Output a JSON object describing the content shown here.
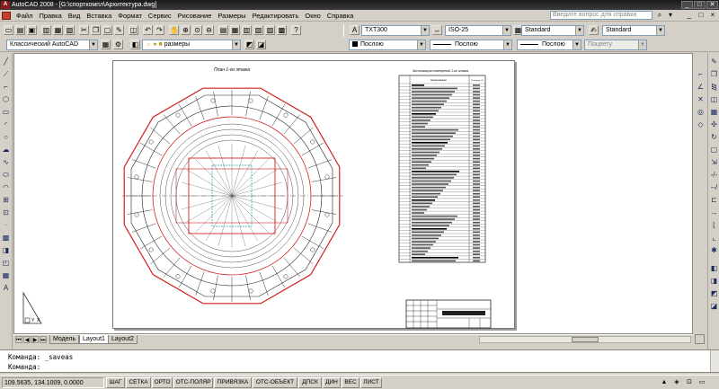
{
  "window": {
    "title": "AutoCAD 2008 - [G:\\спорткомпл\\Архитектура.dwg]",
    "app_logo": "A",
    "controls": [
      "_",
      "□",
      "✕"
    ]
  },
  "menu": {
    "items": [
      "Файл",
      "Правка",
      "Вид",
      "Вставка",
      "Формат",
      "Сервис",
      "Рисование",
      "Размеры",
      "Редактировать",
      "Окно",
      "Справка"
    ],
    "help_placeholder": "Введите вопрос для справки",
    "doc_controls": [
      "_",
      "□",
      "×"
    ]
  },
  "styles_toolbar": {
    "text_style": "TXT300",
    "dim_style": "ISO-25",
    "table_style": "Standard",
    "mleader_style": "Standard"
  },
  "workspace_toolbar": {
    "workspace": "Классический AutoCAD"
  },
  "layers_toolbar": {
    "layer": "размеры"
  },
  "properties_toolbar": {
    "color": "Послою",
    "linetype": "Послою",
    "lineweight": "Послою",
    "plotstyle": "Поцвету"
  },
  "drawing": {
    "plan_title": "План 1-го этажа",
    "table_title": "Экспликация помещений 1-го этажа",
    "table_header_name": "Наименование",
    "table_header_area": "Площадь, м²",
    "table_rows": 56,
    "colors": {
      "red": "#d42020",
      "plan_line": "#202020",
      "court": "#20a0b0",
      "grid_marker": "#303030"
    }
  },
  "layout_tabs": [
    "Модель",
    "Layout1",
    "Layout2"
  ],
  "active_tab": "Layout1",
  "command_lines": [
    "Команда: _saveas",
    "Команда:"
  ],
  "status": {
    "coords": "109.5635, 134.1009, 0.0000",
    "buttons": [
      "ШАГ",
      "СЕТКА",
      "ОРТО",
      "ОТС-ПОЛЯР",
      "ПРИВЯЗКА",
      "ОТС-ОБЪЕКТ",
      "ДПСК",
      "ДИН",
      "ВЕС",
      "ЛИСТ"
    ]
  },
  "icons": [
    "save-icon",
    "open-icon",
    "print-icon",
    "undo-icon",
    "redo-icon",
    "pan-icon",
    "zoom-icon",
    "properties-icon",
    "help-icon",
    "layer-icon",
    "line-icon",
    "circle-icon",
    "arc-icon",
    "move-icon",
    "erase-icon"
  ]
}
